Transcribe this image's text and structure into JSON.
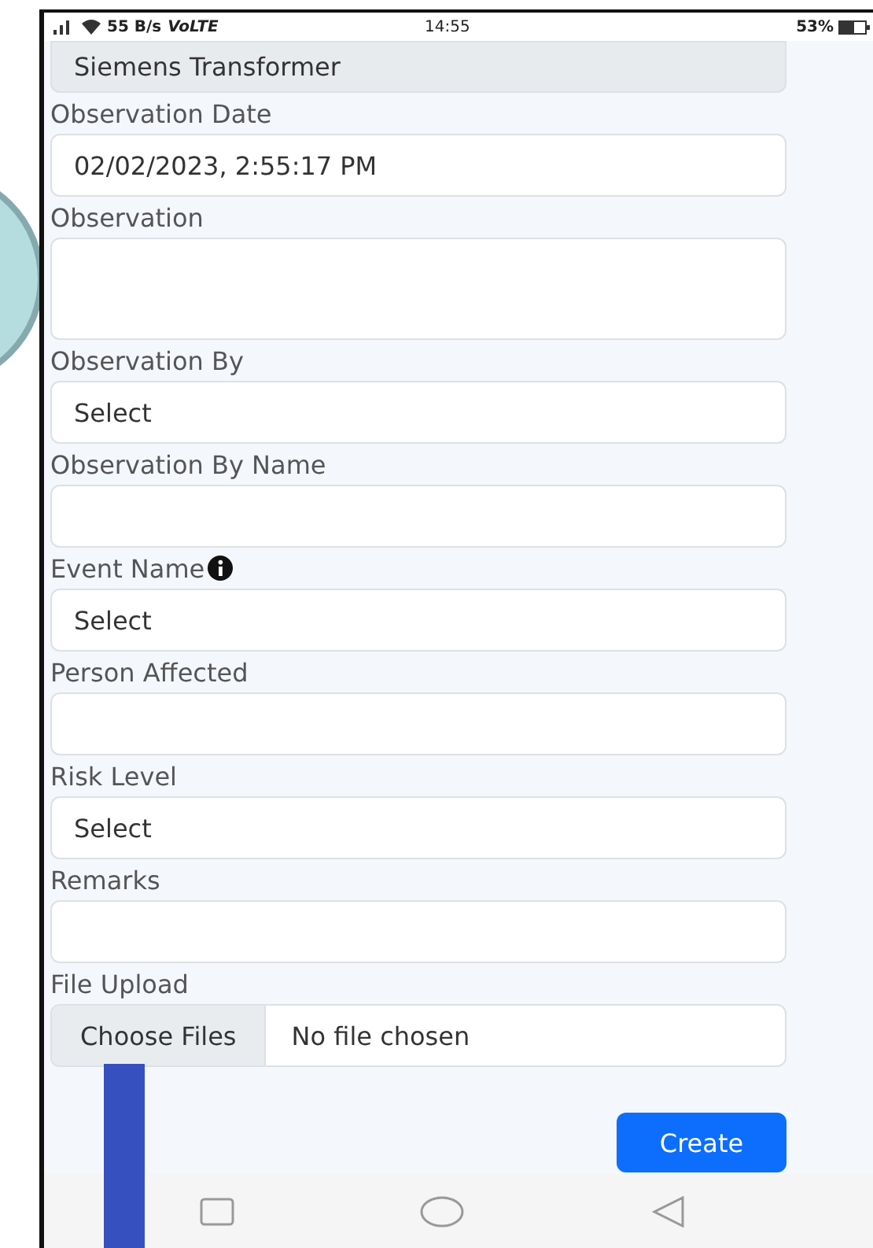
{
  "status_bar": {
    "speed": "55 B/s",
    "network": "VoLTE",
    "time": "14:55",
    "battery": "53%"
  },
  "fields": [
    {
      "kind": "text",
      "value": "Siemens Transformer",
      "disabled": true
    },
    {
      "kind": "text",
      "label": "Observation Date",
      "value": "02/02/2023, 2:55:17 PM",
      "info": false,
      "disabled": false
    },
    {
      "kind": "textarea",
      "label": "Observation",
      "info": false,
      "disabled": false
    },
    {
      "kind": "select",
      "label": "Observation By",
      "value": "Select",
      "info": false,
      "disabled": false
    },
    {
      "kind": "text",
      "label": "Observation By Name",
      "info": false,
      "disabled": false
    },
    {
      "kind": "select",
      "label": "Event Name",
      "value": "Select",
      "info": true,
      "disabled": false
    },
    {
      "kind": "text",
      "label": "Person Affected",
      "info": false,
      "disabled": false
    },
    {
      "kind": "select",
      "label": "Risk Level",
      "value": "Select",
      "info": false,
      "disabled": false
    },
    {
      "kind": "text",
      "label": "Remarks",
      "info": false,
      "disabled": false
    },
    {
      "kind": "file",
      "label": "File Upload",
      "button": "Choose Files",
      "status": "No file chosen",
      "info": false,
      "disabled": false
    }
  ],
  "submit": "Create"
}
